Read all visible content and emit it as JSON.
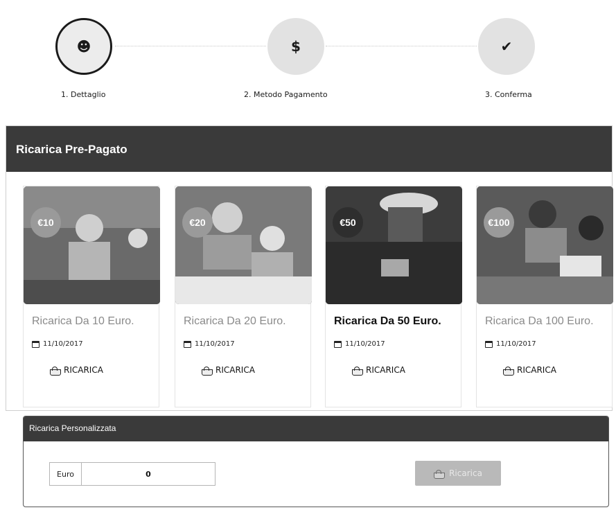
{
  "stepper": {
    "steps": [
      {
        "label": "1. Dettaglio",
        "icon": "user-icon",
        "glyph": "☻"
      },
      {
        "label": "2. Metodo Pagamento",
        "icon": "dollar-icon",
        "glyph": "$"
      },
      {
        "label": "3. Conferma",
        "icon": "check-icon",
        "glyph": "✔"
      }
    ]
  },
  "prepaid": {
    "title": "Ricarica Pre-Pagato",
    "cards": [
      {
        "badge": "€10",
        "title": "Ricarica Da 10 Euro.",
        "date": "11/10/2017",
        "button": "RICARICA"
      },
      {
        "badge": "€20",
        "title": "Ricarica Da 20 Euro.",
        "date": "11/10/2017",
        "button": "RICARICA"
      },
      {
        "badge": "€50",
        "title": "Ricarica Da 50 Euro.",
        "date": "11/10/2017",
        "button": "RICARICA"
      },
      {
        "badge": "€100",
        "title": "Ricarica Da 100 Euro.",
        "date": "11/10/2017",
        "button": "RICARICA"
      }
    ]
  },
  "custom": {
    "title": "Ricarica Personalizzata",
    "currency_label": "Euro",
    "amount": "0",
    "button": "Ricarica"
  }
}
